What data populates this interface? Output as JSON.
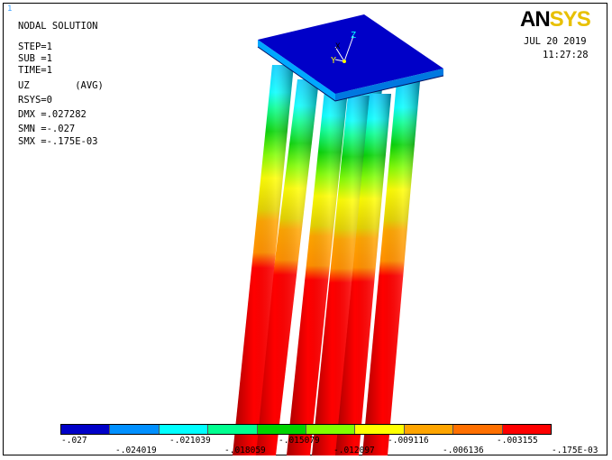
{
  "window_number": "1",
  "logo": "ANSYS",
  "header": {
    "title": "NODAL SOLUTION",
    "lines": [
      "STEP=1",
      "SUB =1",
      "TIME=1",
      "UZ        (AVG)",
      "RSYS=0",
      "DMX =.027282",
      "SMN =-.027",
      "SMX =-.175E-03"
    ]
  },
  "date": "JUL 20 2019",
  "time": "11:27:28",
  "triad": {
    "x": "X",
    "y": "Y",
    "z": "Z"
  },
  "legend": {
    "colors": [
      "#0000c8",
      "#0090ff",
      "#00ffff",
      "#00ff90",
      "#00d400",
      "#80ff00",
      "#ffff00",
      "#ffa500",
      "#ff7000",
      "#ff0000"
    ],
    "labels_top": [
      "-.027",
      "-.021039",
      "-.015079",
      "-.009116",
      "-.003155"
    ],
    "labels_bottom": [
      "-.024019",
      "-.018059",
      "-.012097",
      "-.006136",
      "-.175E-03"
    ]
  }
}
